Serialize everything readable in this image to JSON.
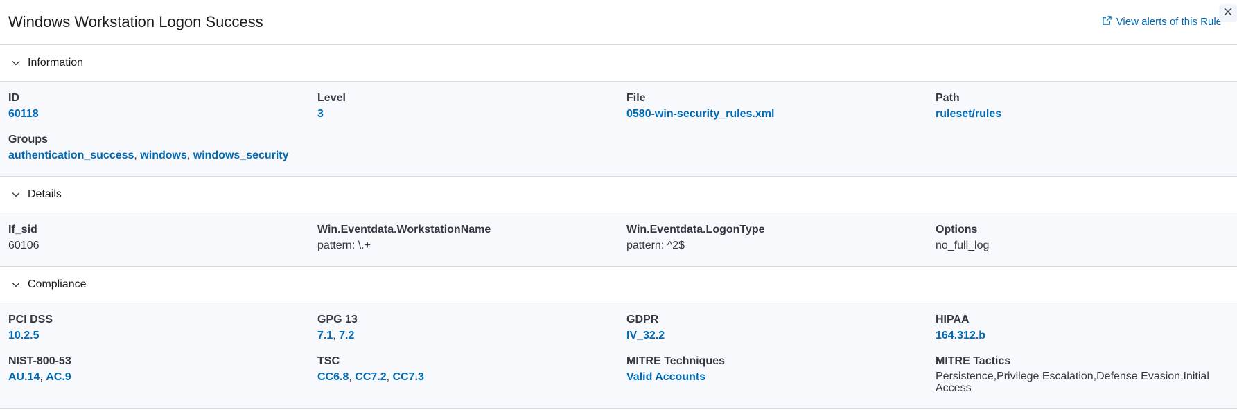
{
  "header": {
    "title": "Windows Workstation Logon Success",
    "view_alerts_label": "View alerts of this Rule"
  },
  "sections": {
    "information": {
      "title": "Information",
      "id_label": "ID",
      "id_value": "60118",
      "level_label": "Level",
      "level_value": "3",
      "file_label": "File",
      "file_value": "0580-win-security_rules.xml",
      "path_label": "Path",
      "path_value": "ruleset/rules",
      "groups_label": "Groups",
      "groups": [
        "authentication_success",
        "windows",
        "windows_security"
      ]
    },
    "details": {
      "title": "Details",
      "if_sid_label": "If_sid",
      "if_sid_value": "60106",
      "workstation_label": "Win.Eventdata.WorkstationName",
      "workstation_value": "pattern: \\.+",
      "logontype_label": "Win.Eventdata.LogonType",
      "logontype_value": "pattern: ^2$",
      "options_label": "Options",
      "options_value": "no_full_log"
    },
    "compliance": {
      "title": "Compliance",
      "pci_label": "PCI DSS",
      "pci": [
        "10.2.5"
      ],
      "gpg_label": "GPG 13",
      "gpg": [
        "7.1",
        "7.2"
      ],
      "gdpr_label": "GDPR",
      "gdpr": [
        "IV_32.2"
      ],
      "hipaa_label": "HIPAA",
      "hipaa": [
        "164.312.b"
      ],
      "nist_label": "NIST-800-53",
      "nist": [
        "AU.14",
        "AC.9"
      ],
      "tsc_label": "TSC",
      "tsc": [
        "CC6.8",
        "CC7.2",
        "CC7.3"
      ],
      "mitre_tech_label": "MITRE Techniques",
      "mitre_tech": [
        "Valid Accounts"
      ],
      "mitre_tactics_label": "MITRE Tactics",
      "mitre_tactics_value": "Persistence,Privilege Escalation,Defense Evasion,Initial Access"
    }
  },
  "colors": {
    "link": "#006bb4",
    "border": "#d3dae6",
    "panel": "#f7f9fc"
  },
  "icons": {
    "external": "popout-icon",
    "close": "close-icon",
    "chevron": "chevron-down-icon"
  }
}
